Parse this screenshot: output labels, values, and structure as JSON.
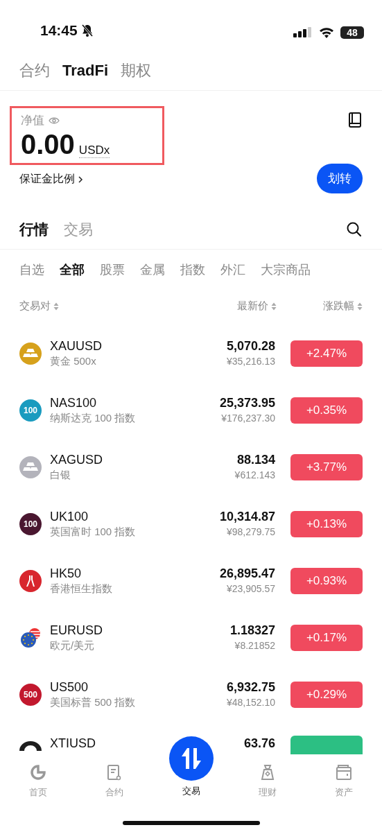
{
  "status_bar": {
    "time": "14:45",
    "battery": "48"
  },
  "top_tabs": [
    {
      "label": "合约",
      "selected": false
    },
    {
      "label": "TradFi",
      "selected": true
    },
    {
      "label": "期权",
      "selected": false
    }
  ],
  "balance": {
    "label": "净值",
    "amount": "0.00",
    "unit": "USDx",
    "highlighted": true,
    "margin_link": "保证金比例",
    "transfer_button": "划转"
  },
  "market_tabs": [
    {
      "label": "行情",
      "selected": true
    },
    {
      "label": "交易",
      "selected": false
    }
  ],
  "categories": [
    {
      "label": "自选",
      "selected": false
    },
    {
      "label": "全部",
      "selected": true
    },
    {
      "label": "股票",
      "selected": false
    },
    {
      "label": "金属",
      "selected": false
    },
    {
      "label": "指数",
      "selected": false
    },
    {
      "label": "外汇",
      "selected": false
    },
    {
      "label": "大宗商品",
      "selected": false
    }
  ],
  "table": {
    "columns": [
      "交易对",
      "最新价",
      "涨跌幅"
    ],
    "rows": [
      {
        "icon": {
          "kind": "bars",
          "color": "#d6a11c"
        },
        "name": "XAUUSD",
        "subtitle": "黄金 500x",
        "price": "5,070.28",
        "price_cny": "¥35,216.13",
        "change": "+2.47%",
        "color": "#f04a5e"
      },
      {
        "icon": {
          "kind": "number",
          "color": "#1a9bbf",
          "text": "100"
        },
        "name": "NAS100",
        "subtitle": "纳斯达克 100 指数",
        "price": "25,373.95",
        "price_cny": "¥176,237.30",
        "change": "+0.35%",
        "color": "#f04a5e"
      },
      {
        "icon": {
          "kind": "bars",
          "color": "#b3b3bb"
        },
        "name": "XAGUSD",
        "subtitle": "白银",
        "price": "88.134",
        "price_cny": "¥612.143",
        "change": "+3.77%",
        "color": "#f04a5e"
      },
      {
        "icon": {
          "kind": "number",
          "color": "#4a1730",
          "text": "100"
        },
        "name": "UK100",
        "subtitle": "英国富时 100 指数",
        "price": "10,314.87",
        "price_cny": "¥98,279.75",
        "change": "+0.13%",
        "color": "#f04a5e"
      },
      {
        "icon": {
          "kind": "pillars",
          "color": "#d8262e"
        },
        "name": "HK50",
        "subtitle": "香港恒生指数",
        "price": "26,895.47",
        "price_cny": "¥23,905.57",
        "change": "+0.93%",
        "color": "#f04a5e"
      },
      {
        "icon": {
          "kind": "flags",
          "color": "#2a5ab8"
        },
        "name": "EURUSD",
        "subtitle": "欧元/美元",
        "price": "1.18327",
        "price_cny": "¥8.21852",
        "change": "+0.17%",
        "color": "#f04a5e"
      },
      {
        "icon": {
          "kind": "number",
          "color": "#c2182e",
          "text": "500"
        },
        "name": "US500",
        "subtitle": "美国标普 500 指数",
        "price": "6,932.75",
        "price_cny": "¥48,152.10",
        "change": "+0.29%",
        "color": "#f04a5e"
      },
      {
        "icon": {
          "kind": "arch",
          "color": "#1e1e1e"
        },
        "name": "XTIUSD",
        "price": "63.76",
        "color": "#2cbf83"
      }
    ]
  },
  "bottom_nav": [
    {
      "label": "首页",
      "kind": "home",
      "selected": false
    },
    {
      "label": "合约",
      "kind": "contract",
      "selected": false
    },
    {
      "label": "交易",
      "kind": "trade",
      "selected": true
    },
    {
      "label": "理财",
      "kind": "finance",
      "selected": false
    },
    {
      "label": "资产",
      "kind": "wallet",
      "selected": false
    }
  ]
}
